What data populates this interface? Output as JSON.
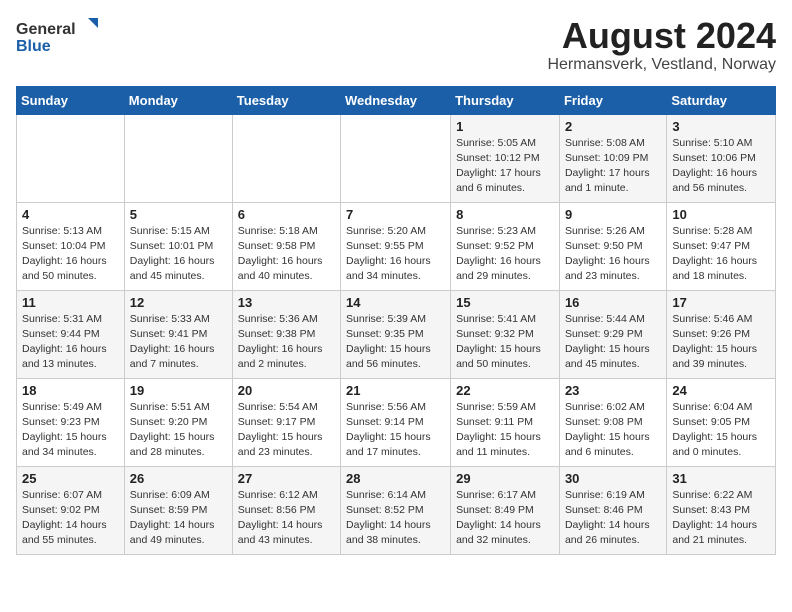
{
  "header": {
    "logo_general": "General",
    "logo_blue": "Blue",
    "title": "August 2024",
    "subtitle": "Hermansverk, Vestland, Norway"
  },
  "calendar": {
    "days_of_week": [
      "Sunday",
      "Monday",
      "Tuesday",
      "Wednesday",
      "Thursday",
      "Friday",
      "Saturday"
    ],
    "weeks": [
      [
        {
          "num": "",
          "detail": ""
        },
        {
          "num": "",
          "detail": ""
        },
        {
          "num": "",
          "detail": ""
        },
        {
          "num": "",
          "detail": ""
        },
        {
          "num": "1",
          "detail": "Sunrise: 5:05 AM\nSunset: 10:12 PM\nDaylight: 17 hours\nand 6 minutes."
        },
        {
          "num": "2",
          "detail": "Sunrise: 5:08 AM\nSunset: 10:09 PM\nDaylight: 17 hours\nand 1 minute."
        },
        {
          "num": "3",
          "detail": "Sunrise: 5:10 AM\nSunset: 10:06 PM\nDaylight: 16 hours\nand 56 minutes."
        }
      ],
      [
        {
          "num": "4",
          "detail": "Sunrise: 5:13 AM\nSunset: 10:04 PM\nDaylight: 16 hours\nand 50 minutes."
        },
        {
          "num": "5",
          "detail": "Sunrise: 5:15 AM\nSunset: 10:01 PM\nDaylight: 16 hours\nand 45 minutes."
        },
        {
          "num": "6",
          "detail": "Sunrise: 5:18 AM\nSunset: 9:58 PM\nDaylight: 16 hours\nand 40 minutes."
        },
        {
          "num": "7",
          "detail": "Sunrise: 5:20 AM\nSunset: 9:55 PM\nDaylight: 16 hours\nand 34 minutes."
        },
        {
          "num": "8",
          "detail": "Sunrise: 5:23 AM\nSunset: 9:52 PM\nDaylight: 16 hours\nand 29 minutes."
        },
        {
          "num": "9",
          "detail": "Sunrise: 5:26 AM\nSunset: 9:50 PM\nDaylight: 16 hours\nand 23 minutes."
        },
        {
          "num": "10",
          "detail": "Sunrise: 5:28 AM\nSunset: 9:47 PM\nDaylight: 16 hours\nand 18 minutes."
        }
      ],
      [
        {
          "num": "11",
          "detail": "Sunrise: 5:31 AM\nSunset: 9:44 PM\nDaylight: 16 hours\nand 13 minutes."
        },
        {
          "num": "12",
          "detail": "Sunrise: 5:33 AM\nSunset: 9:41 PM\nDaylight: 16 hours\nand 7 minutes."
        },
        {
          "num": "13",
          "detail": "Sunrise: 5:36 AM\nSunset: 9:38 PM\nDaylight: 16 hours\nand 2 minutes."
        },
        {
          "num": "14",
          "detail": "Sunrise: 5:39 AM\nSunset: 9:35 PM\nDaylight: 15 hours\nand 56 minutes."
        },
        {
          "num": "15",
          "detail": "Sunrise: 5:41 AM\nSunset: 9:32 PM\nDaylight: 15 hours\nand 50 minutes."
        },
        {
          "num": "16",
          "detail": "Sunrise: 5:44 AM\nSunset: 9:29 PM\nDaylight: 15 hours\nand 45 minutes."
        },
        {
          "num": "17",
          "detail": "Sunrise: 5:46 AM\nSunset: 9:26 PM\nDaylight: 15 hours\nand 39 minutes."
        }
      ],
      [
        {
          "num": "18",
          "detail": "Sunrise: 5:49 AM\nSunset: 9:23 PM\nDaylight: 15 hours\nand 34 minutes."
        },
        {
          "num": "19",
          "detail": "Sunrise: 5:51 AM\nSunset: 9:20 PM\nDaylight: 15 hours\nand 28 minutes."
        },
        {
          "num": "20",
          "detail": "Sunrise: 5:54 AM\nSunset: 9:17 PM\nDaylight: 15 hours\nand 23 minutes."
        },
        {
          "num": "21",
          "detail": "Sunrise: 5:56 AM\nSunset: 9:14 PM\nDaylight: 15 hours\nand 17 minutes."
        },
        {
          "num": "22",
          "detail": "Sunrise: 5:59 AM\nSunset: 9:11 PM\nDaylight: 15 hours\nand 11 minutes."
        },
        {
          "num": "23",
          "detail": "Sunrise: 6:02 AM\nSunset: 9:08 PM\nDaylight: 15 hours\nand 6 minutes."
        },
        {
          "num": "24",
          "detail": "Sunrise: 6:04 AM\nSunset: 9:05 PM\nDaylight: 15 hours\nand 0 minutes."
        }
      ],
      [
        {
          "num": "25",
          "detail": "Sunrise: 6:07 AM\nSunset: 9:02 PM\nDaylight: 14 hours\nand 55 minutes."
        },
        {
          "num": "26",
          "detail": "Sunrise: 6:09 AM\nSunset: 8:59 PM\nDaylight: 14 hours\nand 49 minutes."
        },
        {
          "num": "27",
          "detail": "Sunrise: 6:12 AM\nSunset: 8:56 PM\nDaylight: 14 hours\nand 43 minutes."
        },
        {
          "num": "28",
          "detail": "Sunrise: 6:14 AM\nSunset: 8:52 PM\nDaylight: 14 hours\nand 38 minutes."
        },
        {
          "num": "29",
          "detail": "Sunrise: 6:17 AM\nSunset: 8:49 PM\nDaylight: 14 hours\nand 32 minutes."
        },
        {
          "num": "30",
          "detail": "Sunrise: 6:19 AM\nSunset: 8:46 PM\nDaylight: 14 hours\nand 26 minutes."
        },
        {
          "num": "31",
          "detail": "Sunrise: 6:22 AM\nSunset: 8:43 PM\nDaylight: 14 hours\nand 21 minutes."
        }
      ]
    ]
  }
}
